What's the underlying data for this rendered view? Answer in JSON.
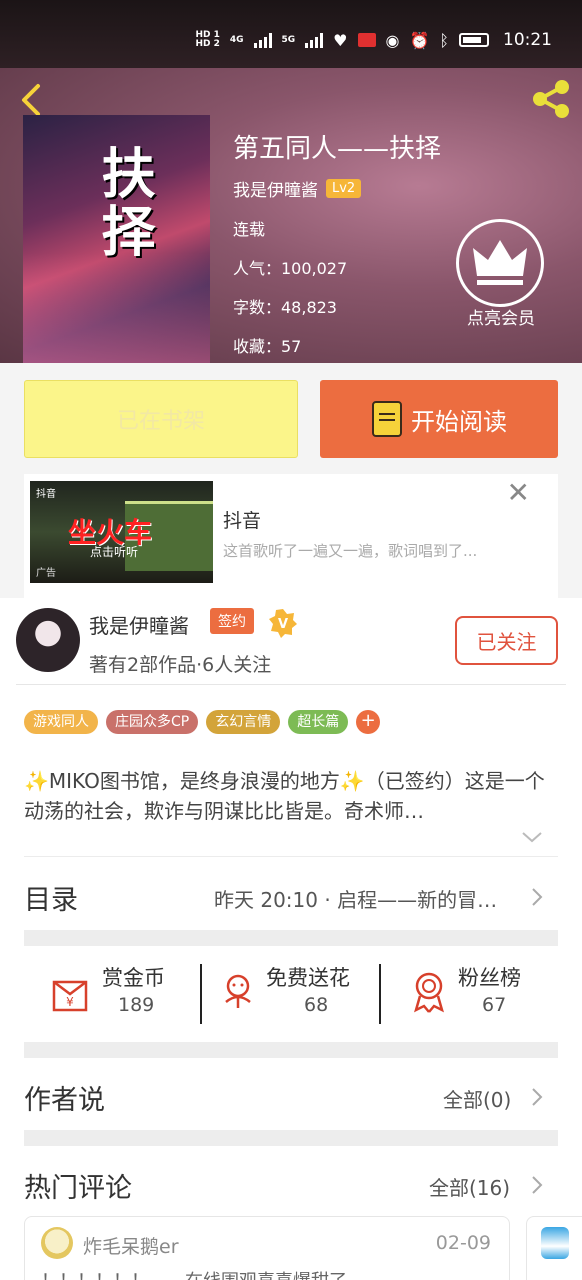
{
  "status_bar": {
    "hd1": "HD 1",
    "hd2": "HD 2",
    "net1": "4G",
    "net2": "5G",
    "time": "10:21"
  },
  "book": {
    "cover_title": "扶择",
    "title": "第五同人——扶择",
    "author": "我是伊瞳酱",
    "level": "Lv2",
    "status": "连载",
    "popularity": "人气：100,027",
    "word_count": "字数：48,823",
    "favorites": "收藏：57",
    "vip_label": "点亮会员"
  },
  "buttons": {
    "shelf": "已在书架",
    "read": "开始阅读"
  },
  "ad": {
    "brand": "抖音",
    "image_text": "坐火车",
    "image_subtext": "点击听听",
    "tag": "广告",
    "title": "抖音",
    "desc": "这首歌听了一遍又一遍，歌词唱到了..."
  },
  "author_card": {
    "name": "我是伊瞳酱",
    "sign_badge": "签约",
    "meta": "著有2部作品·6人关注",
    "follow": "已关注"
  },
  "tags": [
    {
      "label": "游戏同人",
      "color": "#f2b44a"
    },
    {
      "label": "庄园众多CP",
      "color": "#c9716a"
    },
    {
      "label": "玄幻言情",
      "color": "#d3a43a"
    },
    {
      "label": "超长篇",
      "color": "#7dbb55"
    }
  ],
  "tag_more": "+",
  "intro": "✨MIKO图书馆，是终身浪漫的地方✨（已签约）这是一个动荡的社会，欺诈与阴谋比比皆是。奇术师…",
  "toc": {
    "label": "目录",
    "latest": "昨天 20:10 · 启程——新的冒…"
  },
  "stats": [
    {
      "label": "赏金币",
      "value": "189",
      "icon": "red-envelope-icon"
    },
    {
      "label": "免费送花",
      "value": "68",
      "icon": "flower-icon"
    },
    {
      "label": "粉丝榜",
      "value": "67",
      "icon": "medal-icon"
    }
  ],
  "author_says": {
    "label": "作者说",
    "all": "全部(0)"
  },
  "hot_comments": {
    "label": "热门评论",
    "all": "全部(16)",
    "first": {
      "name": "炸毛呆鹅er",
      "date": "02-09",
      "body": "！！！！！！……在线围观喜喜爆甜了……"
    }
  },
  "colors": {
    "accent": "#ec6d40",
    "shelf_bg": "#fbf58a",
    "follow": "#e0533e",
    "icon_red": "#d7402b"
  }
}
